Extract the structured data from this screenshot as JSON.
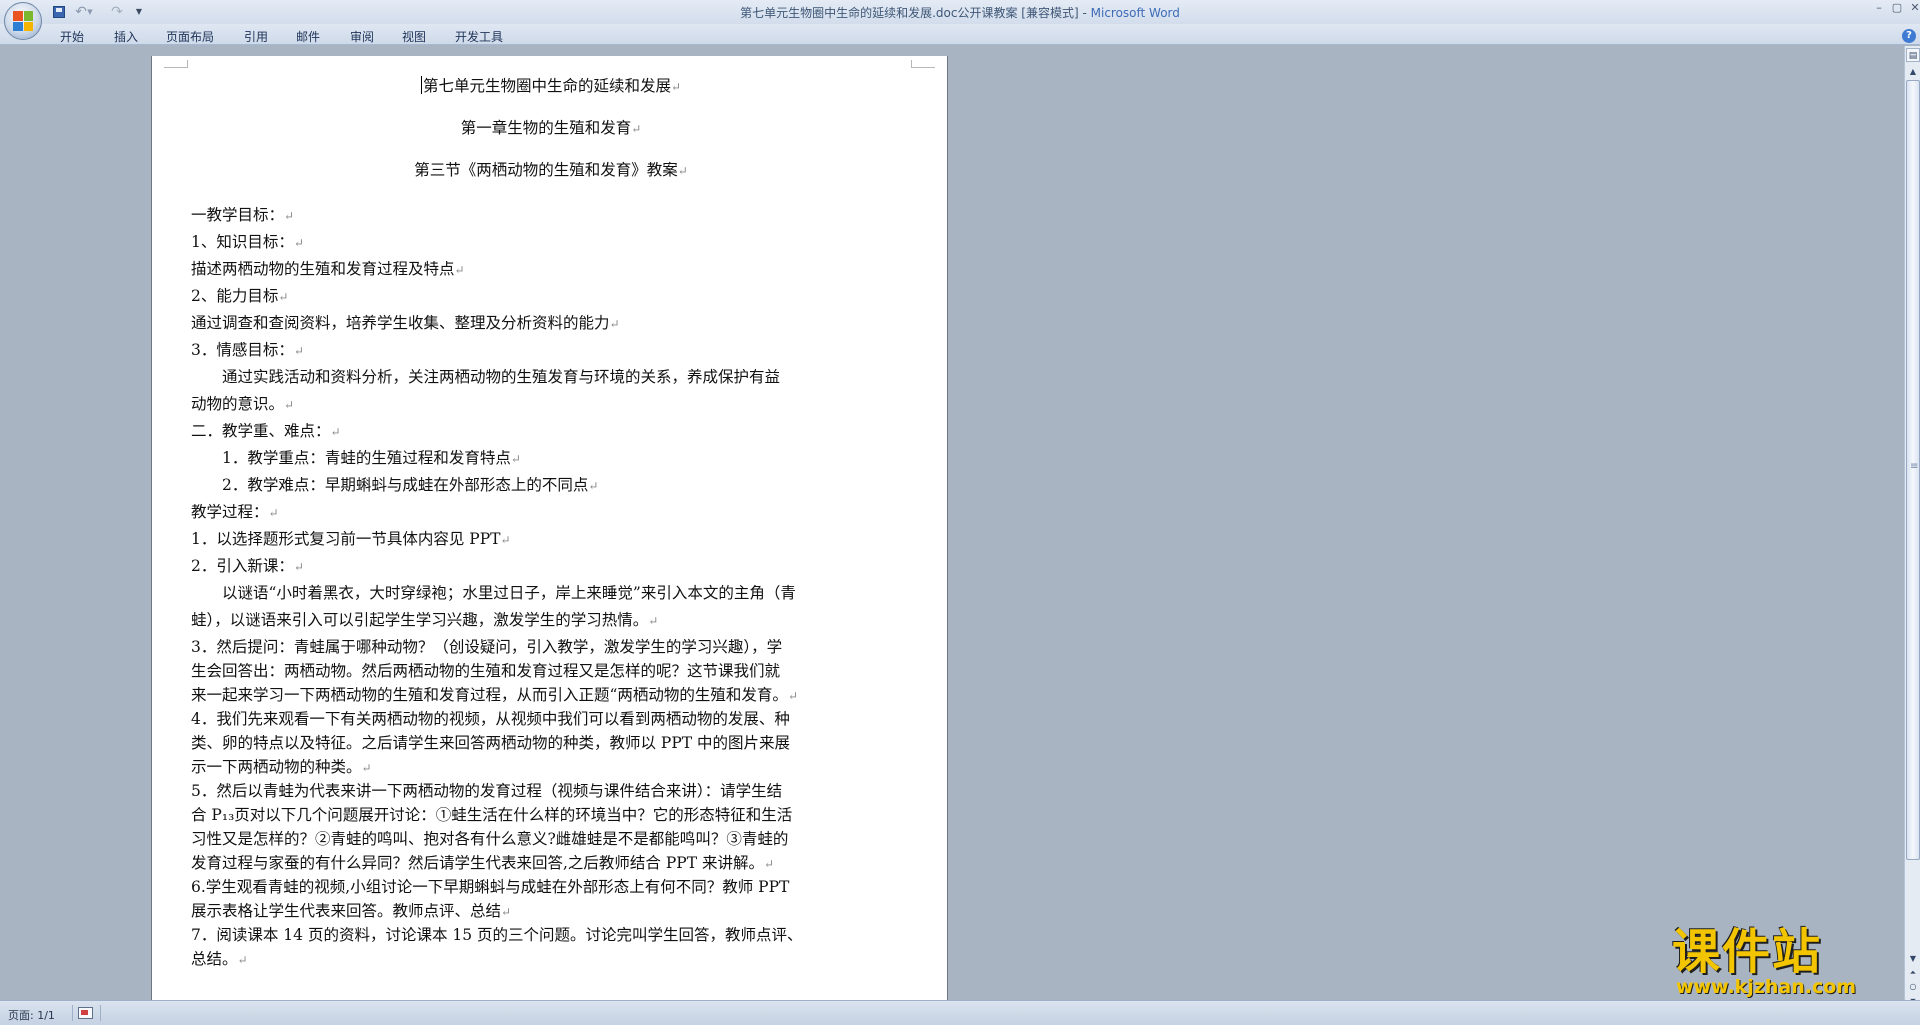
{
  "window": {
    "title_doc": "第七单元生物圈中生命的延续和发展.doc公开课教案 [兼容模式]",
    "title_sep": " - ",
    "title_app": "Microsoft Word"
  },
  "ribbon": {
    "tabs": [
      "开始",
      "插入",
      "页面布局",
      "引用",
      "邮件",
      "审阅",
      "视图",
      "开发工具"
    ]
  },
  "document": {
    "title1": "第七单元生物圈中生命的延续和发展",
    "title2": "第一章生物的生殖和发育",
    "title3": "第三节《两栖动物的生殖和发育》教案",
    "lines": [
      "一教学目标：",
      "1、知识目标：",
      "描述两栖动物的生殖和发育过程及特点",
      "2、能力目标",
      "通过调查和查阅资料，培养学生收集、整理及分析资料的能力",
      "3．情感目标：",
      "　　通过实践活动和资料分析，关注两栖动物的生殖发育与环境的关系，养成保护有益",
      "动物的意识。",
      "二．教学重、难点：",
      "　　1．教学重点：青蛙的生殖过程和发育特点",
      "　　2．教学难点：早期蝌蚪与成蛙在外部形态上的不同点",
      "教学过程：",
      "1．以选择题形式复习前一节具体内容见 PPT",
      "2．引入新课：",
      "　　以谜语“小时着黑衣，大时穿绿袍；水里过日子，岸上来睡觉”来引入本文的主角（青",
      "蛙），以谜语来引入可以引起学生学习兴趣，激发学生的学习热情。",
      "3．然后提问：青蛙属于哪种动物？（创设疑问，引入教学，激发学生的学习兴趣），学",
      "生会回答出：两栖动物。然后两栖动物的生殖和发育过程又是怎样的呢？这节课我们就",
      "来一起来学习一下两栖动物的生殖和发育过程，从而引入正题“两栖动物的生殖和发育。",
      "4．我们先来观看一下有关两栖动物的视频，从视频中我们可以看到两栖动物的发展、种",
      "类、卵的特点以及特征。之后请学生来回答两栖动物的种类，教师以 PPT 中的图片来展",
      "示一下两栖动物的种类。",
      "5．然后以青蛙为代表来讲一下两栖动物的发育过程（视频与课件结合来讲）：请学生结",
      "合 P₁₃页对以下几个问题展开讨论：①蛙生活在什么样的环境当中？它的形态特征和生活",
      "习性又是怎样的？②青蛙的鸣叫、抱对各有什么意义?雌雄蛙是不是都能鸣叫？③青蛙的",
      "发育过程与家蚕的有什么异同？然后请学生代表来回答,之后教师结合 PPT 来讲解。",
      "6.学生观看青蛙的视频,小组讨论一下早期蝌蚪与成蛙在外部形态上有何不同？教师 PPT",
      "展示表格让学生代表来回答。教师点评、总结",
      "7．阅读课本 14 页的资料，讨论课本 15 页的三个问题。讨论完叫学生回答，教师点评、",
      "总结。"
    ],
    "paragraph_marks": [
      "↵",
      "↵",
      "↵",
      "↵",
      "↵",
      "↵",
      "",
      "↵",
      "↵",
      "↵",
      "↵",
      "↵",
      "↵",
      "↵",
      "",
      "↵",
      "",
      "",
      "↵",
      "",
      "",
      "↵",
      "",
      "",
      "",
      "↵",
      "",
      "↵",
      "",
      "↵"
    ]
  },
  "statusbar": {
    "page": "页面: 1/1"
  },
  "watermark": {
    "title": "课件站",
    "url": "www.kjzhan.com"
  },
  "icons": {
    "office_button": "office-logo-icon",
    "save": "save-icon",
    "undo": "undo-icon",
    "redo": "redo-icon",
    "help": "help-icon"
  }
}
